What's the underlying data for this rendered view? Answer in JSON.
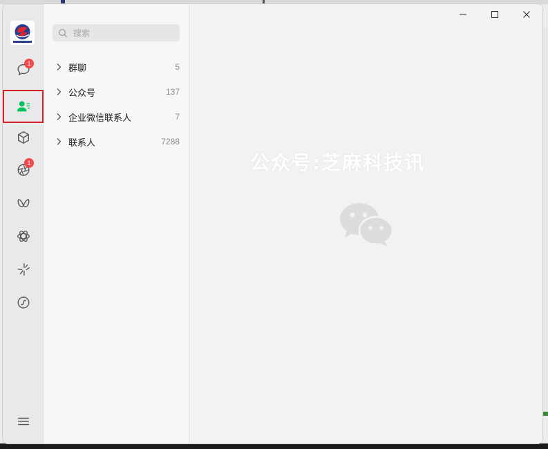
{
  "colors": {
    "accent_green": "#07c160",
    "badge_red": "#f04a4a",
    "highlight_frame": "#d6202a"
  },
  "nav": {
    "items": [
      {
        "name": "chats",
        "icon": "chat-bubble-icon",
        "badge": "1"
      },
      {
        "name": "contacts",
        "icon": "contacts-icon",
        "selected": true
      },
      {
        "name": "favorites",
        "icon": "cube-icon"
      },
      {
        "name": "moments",
        "icon": "aperture-icon",
        "badge": "1"
      },
      {
        "name": "channels",
        "icon": "butterfly-icon"
      },
      {
        "name": "search",
        "icon": "atom-icon"
      },
      {
        "name": "mini-programs",
        "icon": "sparkle-icon"
      },
      {
        "name": "mini-program-panel",
        "icon": "circle-link-icon"
      },
      {
        "name": "menu",
        "icon": "menu-icon"
      }
    ]
  },
  "search": {
    "placeholder": "搜索"
  },
  "contact_groups": [
    {
      "label": "群聊",
      "count": "5"
    },
    {
      "label": "公众号",
      "count": "137"
    },
    {
      "label": "企业微信联系人",
      "count": "7"
    },
    {
      "label": "联系人",
      "count": "7288"
    }
  ],
  "content": {
    "watermark": "公众号:芝麻科技讯",
    "logo_icon": "wechat-logo-icon"
  },
  "window_controls": [
    "minimize-icon",
    "maximize-icon",
    "close-icon"
  ]
}
